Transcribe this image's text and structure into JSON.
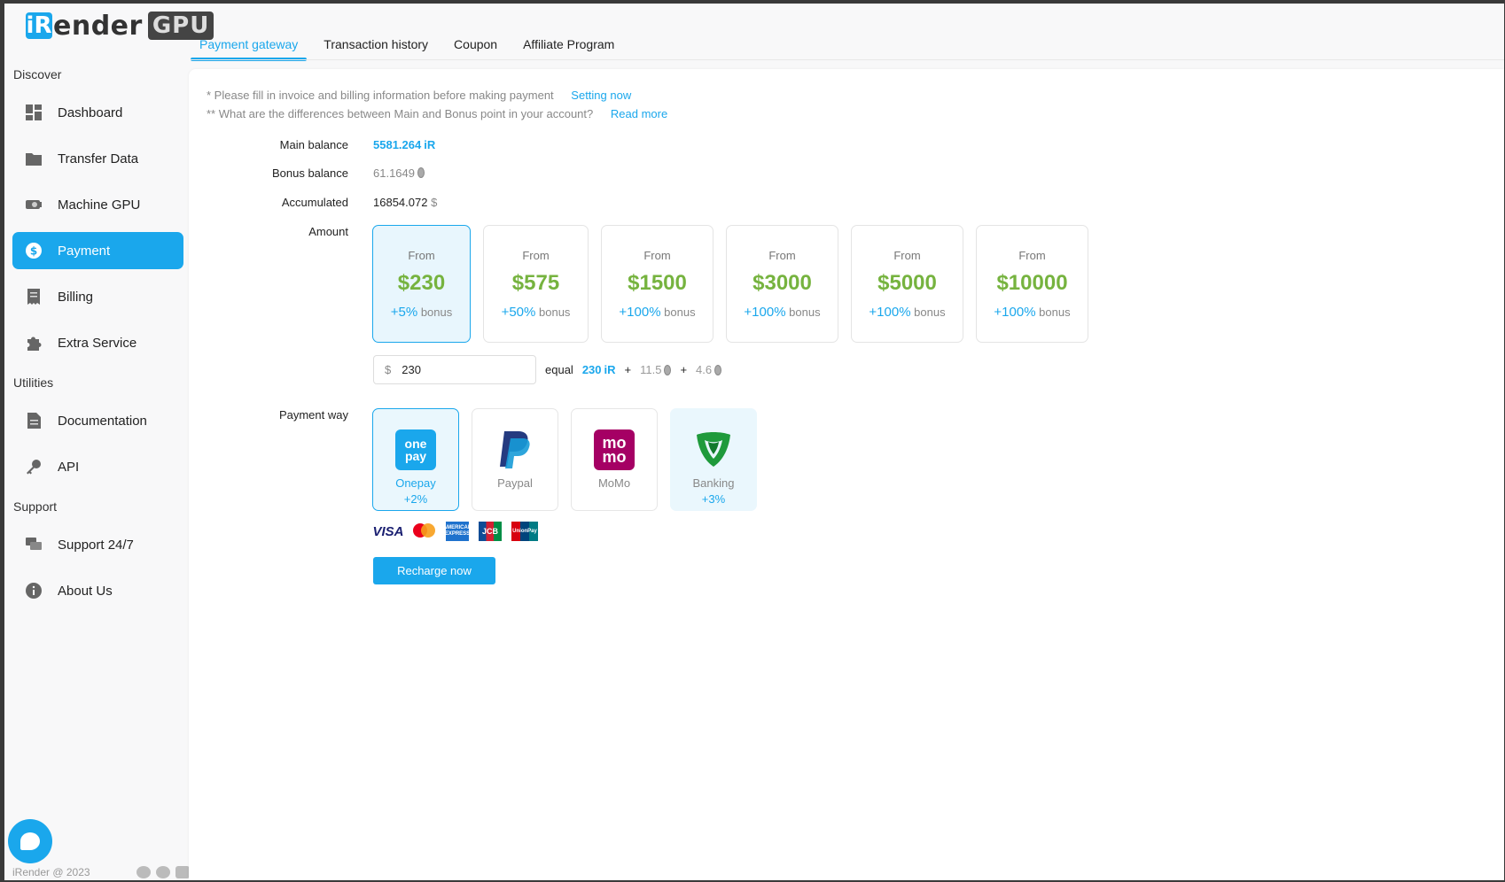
{
  "logo": {
    "ir": "iR",
    "ender": "ender",
    "gpu": "GPU"
  },
  "tabs": [
    {
      "label": "Payment gateway"
    },
    {
      "label": "Transaction history"
    },
    {
      "label": "Coupon"
    },
    {
      "label": "Affiliate Program"
    }
  ],
  "sidebar": {
    "groups": [
      {
        "title": "Discover"
      },
      {
        "title": "Utilities"
      },
      {
        "title": "Support"
      }
    ],
    "items": [
      {
        "label": "Dashboard"
      },
      {
        "label": "Transfer Data"
      },
      {
        "label": "Machine GPU"
      },
      {
        "label": "Payment"
      },
      {
        "label": "Billing"
      },
      {
        "label": "Extra Service"
      },
      {
        "label": "Documentation"
      },
      {
        "label": "API"
      },
      {
        "label": "Support 24/7"
      },
      {
        "label": "About Us"
      }
    ]
  },
  "footer": {
    "copyright": "iRender @ 2023"
  },
  "notes": [
    {
      "text": "* Please fill in invoice and billing information before making payment",
      "link": "Setting now"
    },
    {
      "text": "** What are the differences between Main and Bonus point in your account?",
      "link": "Read more"
    }
  ],
  "balances": {
    "main_label": "Main balance",
    "main_value": "5581.264",
    "bonus_label": "Bonus balance",
    "bonus_value": "61.1649",
    "acc_label": "Accumulated",
    "acc_value": "16854.072",
    "acc_unit": "$"
  },
  "amount": {
    "label": "Amount",
    "cards": [
      {
        "from": "From",
        "price": "$230",
        "bonus": "+5%",
        "bonus_word": "bonus"
      },
      {
        "from": "From",
        "price": "$575",
        "bonus": "+50%",
        "bonus_word": "bonus"
      },
      {
        "from": "From",
        "price": "$1500",
        "bonus": "+100%",
        "bonus_word": "bonus"
      },
      {
        "from": "From",
        "price": "$3000",
        "bonus": "+100%",
        "bonus_word": "bonus"
      },
      {
        "from": "From",
        "price": "$5000",
        "bonus": "+100%",
        "bonus_word": "bonus"
      },
      {
        "from": "From",
        "price": "$10000",
        "bonus": "+100%",
        "bonus_word": "bonus"
      }
    ],
    "currency": "$",
    "input_value": "230",
    "equal_label": "equal",
    "eq_main": "230",
    "plus": "+",
    "eq_bonus1": "11.5",
    "eq_bonus2": "4.6"
  },
  "payment_way": {
    "label": "Payment way",
    "methods": [
      {
        "name": "Onepay",
        "extra": "+2%",
        "logo_text": "one pay"
      },
      {
        "name": "Paypal",
        "extra": ""
      },
      {
        "name": "MoMo",
        "extra": "",
        "logo_text": "mo mo"
      },
      {
        "name": "Banking",
        "extra": "+3%"
      }
    ],
    "cards": {
      "visa": "VISA",
      "amex": "AMERICAN EXPRESS",
      "jcb": "JCB",
      "unionpay": "UnionPay"
    }
  },
  "recharge_label": "Recharge now",
  "colors": {
    "accent": "#1aa7ec",
    "price": "#76b33f"
  }
}
